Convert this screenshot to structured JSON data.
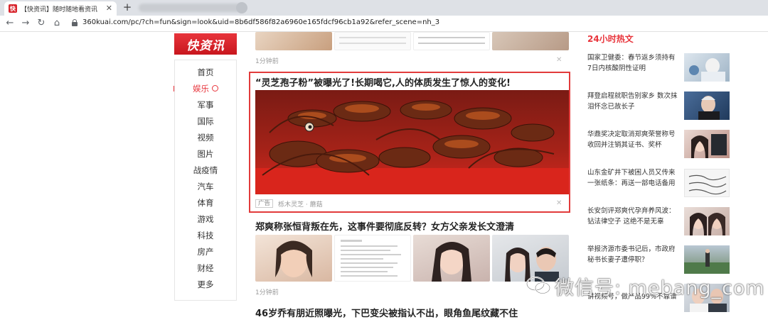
{
  "browser": {
    "tab_icon": "快",
    "tab_title": "【快资讯】随时随地看资讯",
    "url": "360kuai.com/pc/?ch=fun&sign=look&uid=8b6df586f82a6960e165fdcf96cb1a92&refer_scene=nh_3"
  },
  "logo": "快资讯",
  "nav": {
    "items": [
      "首页",
      "娱乐",
      "军事",
      "国际",
      "视频",
      "图片",
      "战疫情",
      "汽车",
      "体育",
      "游戏",
      "科技",
      "房产",
      "财经",
      "更多"
    ],
    "active": "娱乐"
  },
  "feed": {
    "item1_time": "1分钟前",
    "ad": {
      "title": "“灵芝孢子粉”被曝光了!长期喝它,人的体质发生了惊人的变化!",
      "tag": "广告",
      "source": "栎木灵芝 · 蘑菇"
    },
    "news2": {
      "title": "郑爽称张恒背叛在先，这事件要彻底反转？女方父亲发长文澄清",
      "time": "1分钟前"
    },
    "news3": {
      "title": "46岁乔有朋近照曝光，下巴变尖被指认不出，眼角鱼尾纹藏不住"
    }
  },
  "hot": {
    "title": "24小时热文",
    "items": [
      "国家卫健委：春节返乡须持有7日内核酸阴性证明",
      "拜登启程就职告别家乡 数次抹泪怀念已故长子",
      "华鼎奖决定取消郑爽荣誉称号收回并注销其证书、奖杯",
      "山东金矿井下被困人员又传来一张纸条：再送一部电话备用",
      "长安剑评郑爽代孕弃养风波：钻法律空子 这绝不是无辜",
      "举报济源市委书记后，市政府秘书长妻子遭停职？",
      "讲视频号，做产品99%不靠谱"
    ]
  },
  "watermark": "微信号: mebang_com",
  "colors": {
    "accent": "#e8343b",
    "ad_border": "#e23b3b"
  }
}
